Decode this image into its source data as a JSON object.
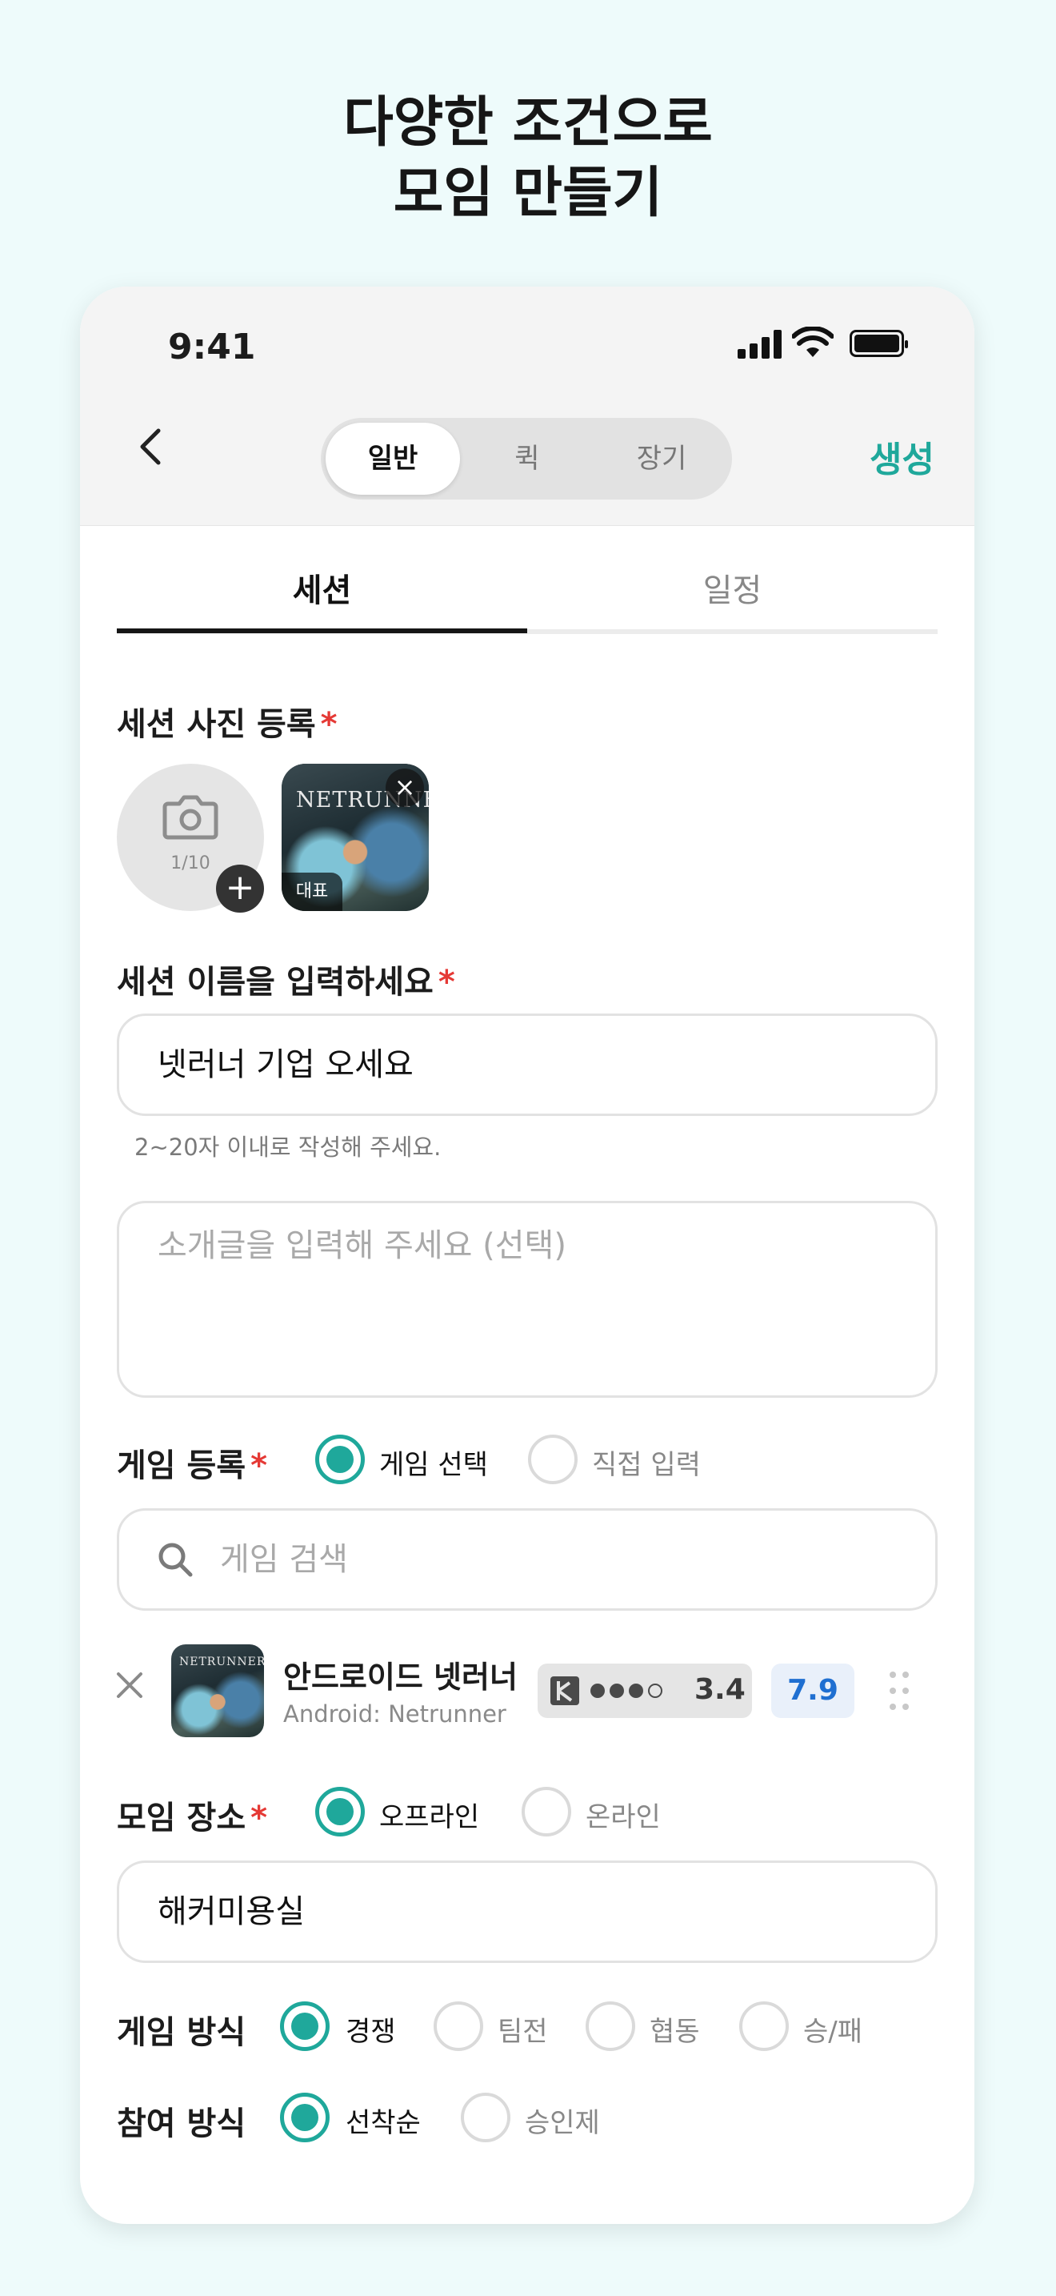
{
  "headline": {
    "line1": "다양한 조건으로",
    "line2": "모임 만들기"
  },
  "status_bar": {
    "time": "9:41"
  },
  "nav": {
    "segments": [
      "일반",
      "퀵",
      "장기"
    ],
    "active_segment": "일반",
    "create_label": "생성"
  },
  "tabs": {
    "items": [
      "세션",
      "일정"
    ],
    "active": "세션"
  },
  "photo": {
    "label": "세션 사진 등록",
    "required_mark": "*",
    "count": "1/10",
    "thumb_title": "NETRUNNER",
    "rep_badge": "대표"
  },
  "name": {
    "label": "세션 이름을 입력하세요",
    "required_mark": "*",
    "value": "넷러너 기업 오세요",
    "helper": "2~20자 이내로 작성해 주세요."
  },
  "intro": {
    "placeholder": "소개글을 입력해 주세요 (선택)"
  },
  "game": {
    "label": "게임 등록",
    "required_mark": "*",
    "options": [
      "게임 선택",
      "직접 입력"
    ],
    "selected": "게임 선택",
    "search_placeholder": "게임 검색",
    "item": {
      "name": "안드로이드 넷러너",
      "subtitle": "Android: Netrunner",
      "thumb_title": "NETRUNNER",
      "weight": "3.4",
      "weight_dots_filled": 3,
      "weight_dots_total": 4,
      "rating": "7.9"
    }
  },
  "place": {
    "label": "모임 장소",
    "required_mark": "*",
    "options": [
      "오프라인",
      "온라인"
    ],
    "selected": "오프라인",
    "value": "해커미용실"
  },
  "play_style": {
    "label": "게임 방식",
    "options": [
      "경쟁",
      "팀전",
      "협동",
      "승/패"
    ],
    "selected": "경쟁"
  },
  "join_method": {
    "label": "참여 방식",
    "options": [
      "선착순",
      "승인제"
    ],
    "selected": "선착순"
  },
  "colors": {
    "accent": "#1fa89b",
    "required": "#e53935",
    "rating": "#1f6fd1",
    "background": "#eefbfb"
  },
  "icons": [
    "chevron-left-icon",
    "signal-icon",
    "wifi-icon",
    "battery-icon",
    "camera-icon",
    "plus-icon",
    "close-icon",
    "search-icon",
    "weight-icon",
    "drag-handle-icon"
  ]
}
